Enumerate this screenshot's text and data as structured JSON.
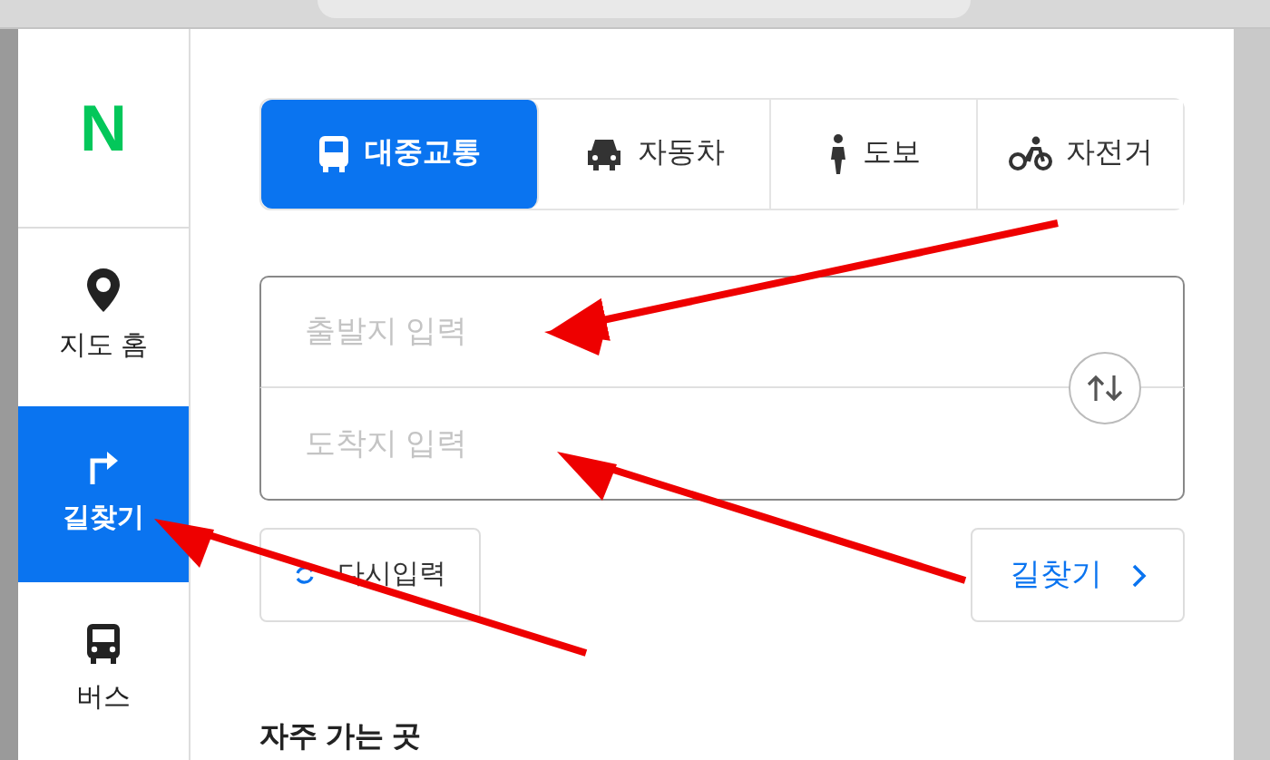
{
  "sidebar": {
    "logo": "N",
    "items": [
      {
        "label": "지도 홈",
        "kind": "home",
        "selected": false
      },
      {
        "label": "길찾기",
        "kind": "directions",
        "selected": true
      },
      {
        "label": "버스",
        "kind": "bus",
        "selected": false
      }
    ]
  },
  "tabs": [
    {
      "label": "대중교통",
      "kind": "transit",
      "selected": true
    },
    {
      "label": "자동차",
      "kind": "car",
      "selected": false
    },
    {
      "label": "도보",
      "kind": "walk",
      "selected": false
    },
    {
      "label": "자전거",
      "kind": "bike",
      "selected": false
    }
  ],
  "route_form": {
    "origin": {
      "placeholder": "출발지 입력"
    },
    "destination": {
      "placeholder": "도착지 입력"
    }
  },
  "buttons": {
    "reset": "다시입력",
    "search": "길찾기"
  },
  "section_heading": "자주 가는 곳"
}
